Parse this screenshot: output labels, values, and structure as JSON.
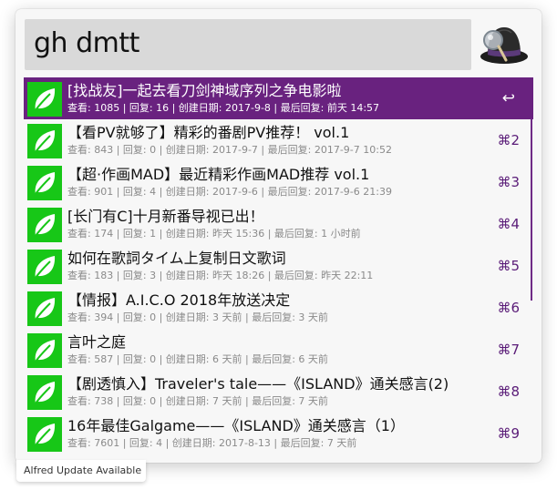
{
  "search": {
    "query": "gh dmtt"
  },
  "results": [
    {
      "title": "[找战友]一起去看刀剑神域序列之争电影啦",
      "subtitle": "查看: 1085 | 回复: 16 | 创建日期: 2017-9-8 | 最后回复: 前天 14:57",
      "shortcut": "↩",
      "icon": "leaf-icon",
      "selected": true
    },
    {
      "title": "【看PV就够了】精彩的番剧PV推荐！ vol.1",
      "subtitle": "查看: 843 | 回复: 0 | 创建日期: 2017-9-7 | 最后回复: 2017-9-7 10:52",
      "shortcut": "⌘2",
      "icon": "leaf-icon"
    },
    {
      "title": "【超·作画MAD】最近精彩作画MAD推荐 vol.1",
      "subtitle": "查看: 901 | 回复: 4 | 创建日期: 2017-9-6 | 最后回复: 2017-9-6 21:39",
      "shortcut": "⌘3",
      "icon": "leaf-icon"
    },
    {
      "title": "[长门有C]十月新番导视已出！",
      "subtitle": "查看: 174 | 回复: 1 | 创建日期: 昨天 15:36 | 最后回复: 1 小时前",
      "shortcut": "⌘4",
      "icon": "leaf-icon"
    },
    {
      "title": "如何在歌詞タイム上复制日文歌词",
      "subtitle": "查看: 183 | 回复: 3 | 创建日期: 昨天 18:26 | 最后回复: 昨天 22:11",
      "shortcut": "⌘5",
      "icon": "leaf-icon"
    },
    {
      "title": "【情报】A.I.C.O 2018年放送决定",
      "subtitle": "查看: 394 | 回复: 0 | 创建日期: 3 天前 | 最后回复: 3 天前",
      "shortcut": "⌘6",
      "icon": "leaf-icon"
    },
    {
      "title": "言叶之庭",
      "subtitle": "查看: 587 | 回复: 0 | 创建日期: 6 天前 | 最后回复: 6 天前",
      "shortcut": "⌘7",
      "icon": "leaf-icon"
    },
    {
      "title": "【剧透慎入】Traveler's tale——《ISLAND》通关感言(2)",
      "subtitle": "查看: 738 | 回复: 0 | 创建日期: 7 天前 | 最后回复: 7 天前",
      "shortcut": "⌘8",
      "icon": "leaf-icon"
    },
    {
      "title": "16年最佳Galgame——《ISLAND》通关感言（1）",
      "subtitle": "查看: 7601 | 回复: 4 | 创建日期: 2017-8-13 | 最后回复: 7 天前",
      "shortcut": "⌘9",
      "icon": "leaf-icon"
    }
  ],
  "update_notice": "Alfred Update Available",
  "logo_icon": "alfred-hat-icon",
  "colors": {
    "selected_row": "#69227f",
    "shortcut": "#5a1c78",
    "icon_tile": "#17c717",
    "search_field": "#d9d9d9"
  }
}
